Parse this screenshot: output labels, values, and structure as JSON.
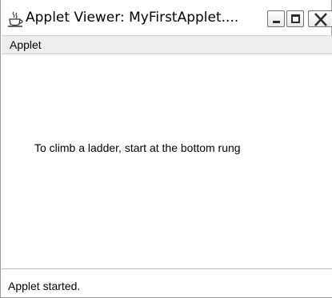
{
  "window": {
    "title": "Applet Viewer: MyFirstApplet....",
    "icon": "java-coffee-cup-icon",
    "controls": [
      "minimize-icon",
      "maximize-icon",
      "close-icon"
    ]
  },
  "menubar": {
    "items": [
      {
        "label": "Applet"
      }
    ]
  },
  "applet": {
    "message": "To climb a ladder, start at the bottom rung"
  },
  "status": {
    "text": "Applet started."
  },
  "colors": {
    "menubar_bg": "#eeeeee",
    "content_bg": "#ffffff",
    "text": "#000000"
  }
}
